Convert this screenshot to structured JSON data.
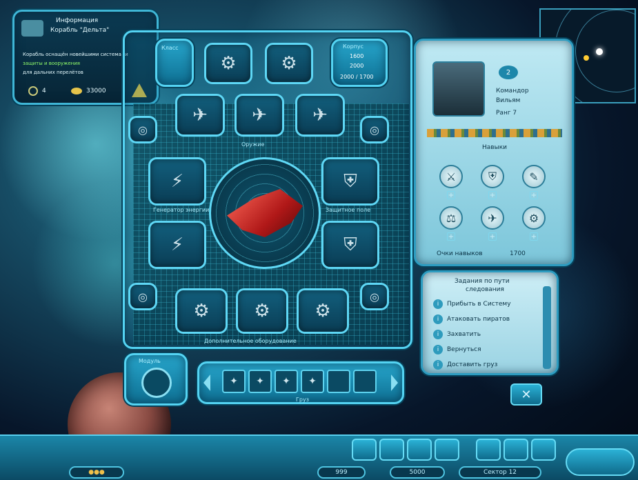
{
  "info_panel": {
    "title_line1": "Информация",
    "title_line2": "Корабль \"Дельта\"",
    "body_line1": "Корабль оснащён новейшими системами",
    "body_line2": "защиты и вооружения",
    "body_line3": "для дальних перелётов",
    "count1": "4",
    "count2": "33000",
    "warning_icon": "warning-icon"
  },
  "ship_stats": {
    "header_left": "Класс",
    "header_right": "Корпус",
    "value1": "1600",
    "value2": "2000",
    "value3": "2000 / 1700"
  },
  "hull_labels": {
    "upper": "Оружие",
    "left": "Генератор энергии",
    "right": "Защитное поле",
    "lower": "Дополнительное оборудование",
    "module": "Модуль",
    "equipment": "Груз"
  },
  "pilot": {
    "name_line1": "Командор",
    "name_line2": "Вильям",
    "rank": "Ранг 7",
    "level": "2",
    "skills_title": "Навыки",
    "points_label": "Очки навыков",
    "points_value": "1700"
  },
  "quests": {
    "title_line1": "Задания по пути",
    "title_line2": "следования",
    "items": [
      "Прибыть в Систему",
      "Атаковать пиратов",
      "Захватить",
      "Вернуться",
      "Доставить груз"
    ]
  },
  "bottom_bar": {
    "left_value": "999",
    "mid_value": "5000",
    "right_label": "Сектор",
    "right_value": "12"
  },
  "colors": {
    "panel": "#1e93b8",
    "accent": "#54d3f2",
    "ship": "#c42a22"
  }
}
